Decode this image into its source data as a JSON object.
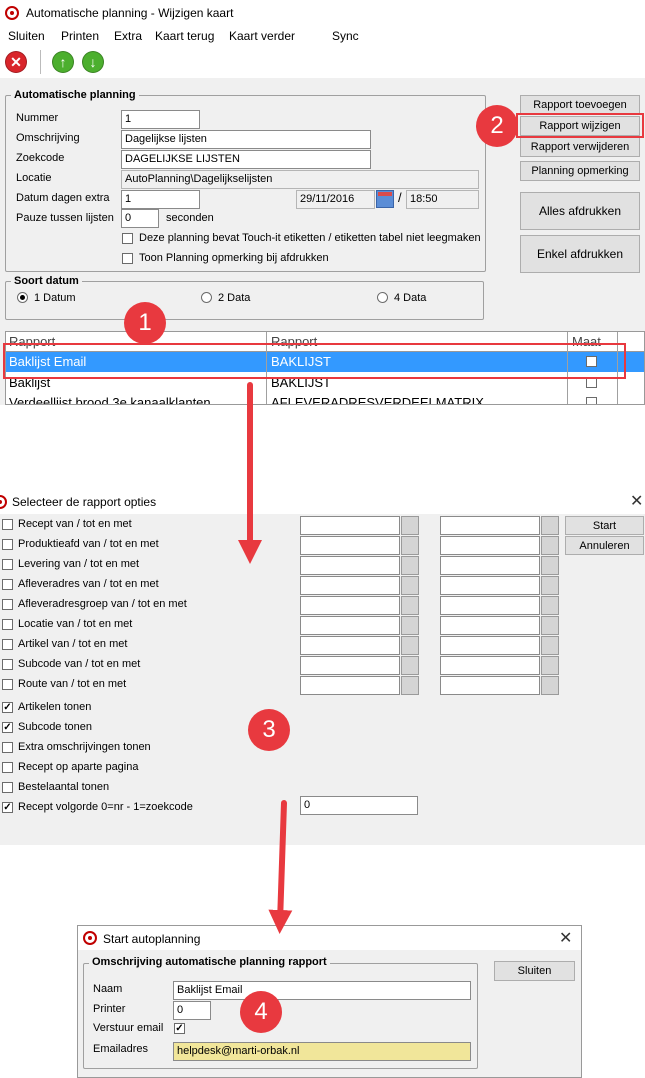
{
  "main_window": {
    "title": "Automatische planning - Wijzigen kaart",
    "menu": [
      "Sluiten",
      "Printen",
      "Extra",
      "Kaart terug",
      "Kaart verder",
      "Sync"
    ],
    "toolbar": {
      "close": "close-icon",
      "up": "arrow-up-icon",
      "down": "arrow-down-icon"
    },
    "group_title": "Automatische planning",
    "nummer_label": "Nummer",
    "nummer_value": "1",
    "omschrijving_label": "Omschrijving",
    "omschrijving_value": "Dagelijkse lijsten",
    "zoekcode_label": "Zoekcode",
    "zoekcode_value": "DAGELIJKSE LIJSTEN",
    "locatie_label": "Locatie",
    "locatie_value": "AutoPlanning\\Dagelijkselijsten",
    "datum_label": "Datum dagen extra",
    "datum_value": "1",
    "date_value": "29/11/2016",
    "date_sep": "/",
    "time_value": "18:50",
    "pauze_label": "Pauze tussen lijsten",
    "pauze_value": "0",
    "pauze_unit": "seconden",
    "touchit_label": "Deze planning bevat Touch-it etiketten / etiketten tabel niet leegmaken",
    "toon_label": "Toon Planning opmerking bij afdrukken",
    "buttons": {
      "toevoegen": "Rapport toevoegen",
      "wijzigen": "Rapport wijzigen",
      "verwijderen": "Rapport verwijderen",
      "opmerking": "Planning opmerking",
      "alles": "Alles afdrukken",
      "enkel": "Enkel afdrukken"
    },
    "soort_title": "Soort datum",
    "radios": [
      "1 Datum",
      "2 Data",
      "4 Data"
    ],
    "grid": {
      "headers": [
        "Rapport",
        "Rapport",
        "Maat"
      ],
      "rows": [
        {
          "name": "Baklijst Email",
          "report": "BAKLIJST"
        },
        {
          "name": "Baklijst",
          "report": "BAKLIJST"
        },
        {
          "name": "Verdeellijst brood 3e kanaalklanten",
          "report": "AFLEVERADRESVERDEELMATRIX"
        }
      ]
    }
  },
  "options_window": {
    "title": "Selecteer de rapport opties",
    "range_labels": [
      "Recept van / tot en met",
      "Produktieafd van / tot en met",
      "Levering van / tot en met",
      "Afleveradres van / tot en met",
      "Afleveradresgroep van / tot en met",
      "Locatie van / tot en met",
      "Artikel van / tot en met",
      "Subcode van / tot en met",
      "Route van / tot en met"
    ],
    "checks": [
      {
        "label": "Artikelen tonen",
        "checked": true
      },
      {
        "label": "Subcode tonen",
        "checked": true
      },
      {
        "label": "Extra omschrijvingen tonen",
        "checked": false
      },
      {
        "label": "Recept op aparte pagina",
        "checked": false
      },
      {
        "label": "Bestelaantal tonen",
        "checked": false
      },
      {
        "label": "Recept volgorde 0=nr - 1=zoekcode",
        "checked": true
      }
    ],
    "volgorde_value": "0",
    "start": "Start",
    "annuleren": "Annuleren"
  },
  "start_window": {
    "title": "Start autoplanning",
    "group_title": "Omschrijving automatische planning rapport",
    "naam_label": "Naam",
    "naam_value": "Baklijst Email",
    "printer_label": "Printer",
    "printer_value": "0",
    "verstuur_label": "Verstuur email",
    "email_label": "Emailadres",
    "email_value": "helpdesk@marti-orbak.nl",
    "sluiten": "Sluiten"
  },
  "badges": [
    "1",
    "2",
    "3",
    "4"
  ],
  "colors": {
    "accent": "#e8393f",
    "selection": "#3399ff",
    "email_field": "#f1e69a"
  }
}
